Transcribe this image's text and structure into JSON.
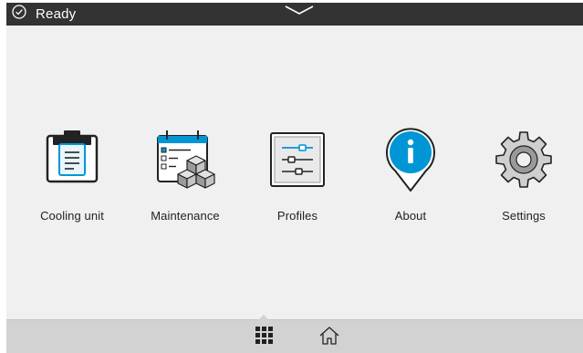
{
  "status_bar": {
    "status_text": "Ready",
    "status_icon": "check-circle-icon",
    "pulldown_icon": "chevron-down-icon"
  },
  "apps": [
    {
      "id": "cooling-unit",
      "label": "Cooling unit",
      "icon": "clipboard-icon"
    },
    {
      "id": "maintenance",
      "label": "Maintenance",
      "icon": "calendar-cubes-icon"
    },
    {
      "id": "profiles",
      "label": "Profiles",
      "icon": "sliders-icon"
    },
    {
      "id": "about",
      "label": "About",
      "icon": "info-pin-icon"
    },
    {
      "id": "settings",
      "label": "Settings",
      "icon": "gear-icon"
    }
  ],
  "bottom_bar": {
    "apps_icon": "grid-icon",
    "home_icon": "home-icon"
  },
  "colors": {
    "top_bar": "#333333",
    "background": "#f0f0f0",
    "bottom_bar": "#d2d2d2",
    "accent_blue": "#0096d6"
  }
}
